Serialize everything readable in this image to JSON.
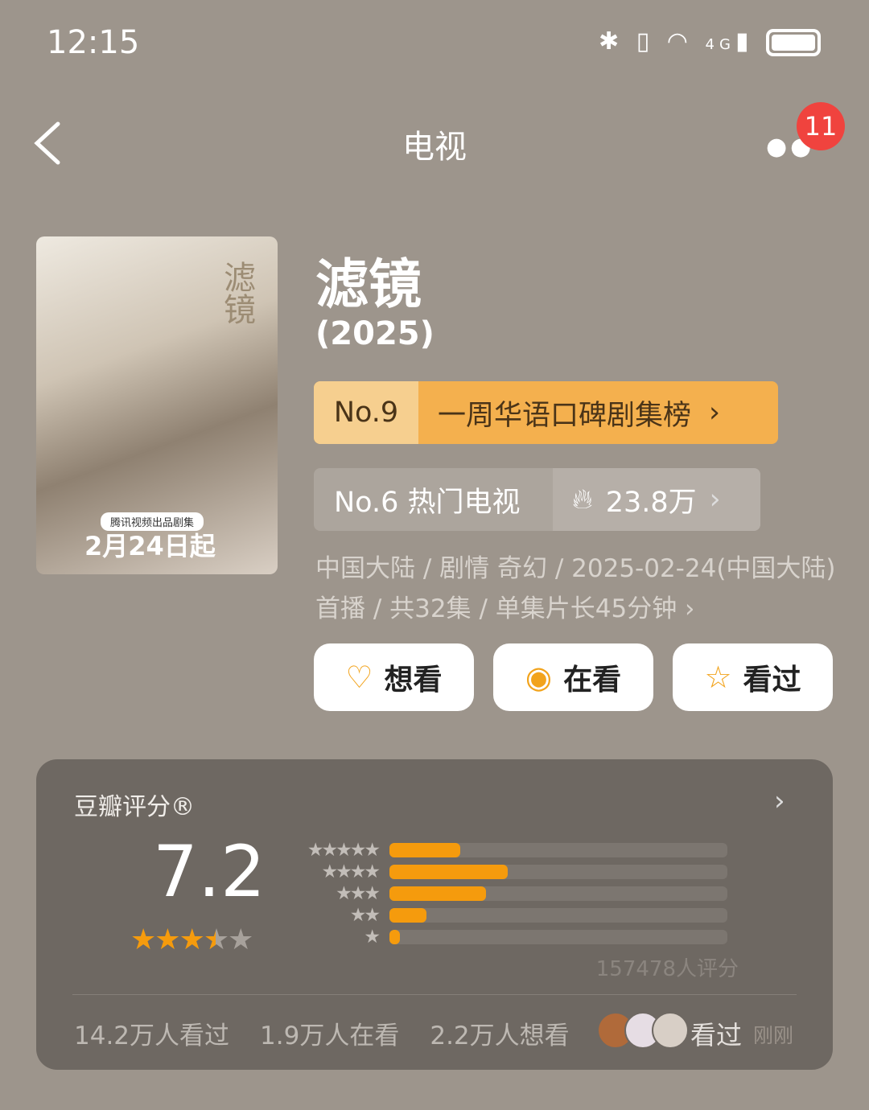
{
  "status_bar": {
    "time": "12:15",
    "network": "4G"
  },
  "header": {
    "title": "电视",
    "notification_count": "11"
  },
  "poster": {
    "title": "滤镜",
    "tag": "腾讯视频出品剧集",
    "date": "2月24日起"
  },
  "show": {
    "name": "滤镜",
    "year": "(2025)"
  },
  "rank_primary": {
    "number": "No.9",
    "label": "一周华语口碑剧集榜"
  },
  "rank_secondary": {
    "label": "No.6 热门电视",
    "heat": "23.8万"
  },
  "meta": "中国大陆 / 剧情 奇幻 / 2025-02-24(中国大陆)首播 / 共32集 / 单集片长45分钟 ›",
  "actions": [
    {
      "label": "想看",
      "icon": "heart-plus-icon"
    },
    {
      "label": "在看",
      "icon": "target-icon"
    },
    {
      "label": "看过",
      "icon": "star-outline-icon"
    }
  ],
  "rating": {
    "title": "豆瓣评分®",
    "score": "7.2",
    "stars": 3.5,
    "distribution_percent": [
      21,
      35,
      28.5,
      11,
      3
    ],
    "count": "157478人评分",
    "accent": "#f59b0d"
  },
  "stats": {
    "watched": "14.2万人看过",
    "watching": "1.9万人在看",
    "want": "2.2万人想看",
    "friend_action": "看过",
    "friend_time": "刚刚"
  }
}
